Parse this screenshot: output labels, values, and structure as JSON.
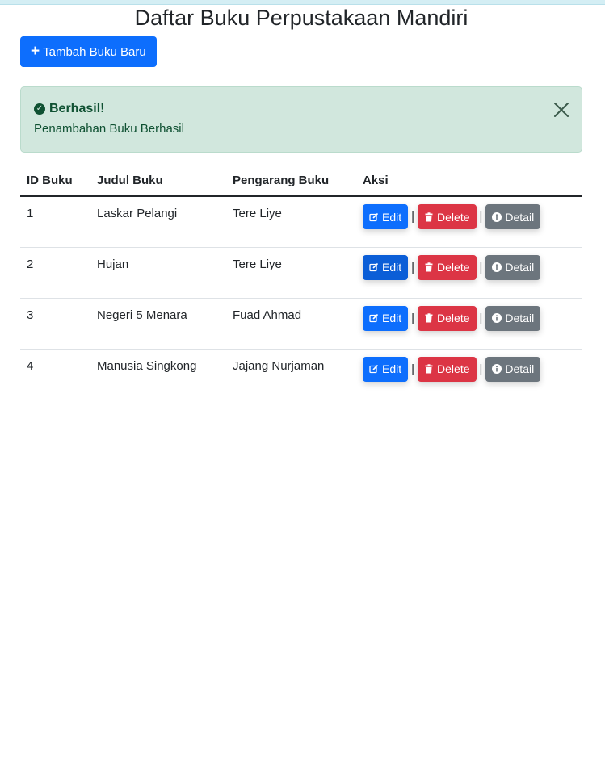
{
  "page": {
    "title": "Daftar Buku Perpustakaan Mandiri",
    "add_button": "Tambah Buku Baru"
  },
  "alert": {
    "heading": "Berhasil!",
    "message": "Penambahan Buku Berhasil",
    "icon": "check-circle-icon",
    "colors": {
      "background": "#d1e7dd",
      "text": "#0f5132"
    }
  },
  "table": {
    "headers": [
      "ID Buku",
      "Judul Buku",
      "Pengarang Buku",
      "Aksi"
    ],
    "rows": [
      {
        "id": "1",
        "judul": "Laskar Pelangi",
        "pengarang": "Tere Liye"
      },
      {
        "id": "2",
        "judul": "Hujan",
        "pengarang": "Tere Liye"
      },
      {
        "id": "3",
        "judul": "Negeri 5 Menara",
        "pengarang": "Fuad Ahmad"
      },
      {
        "id": "4",
        "judul": "Manusia Singkong",
        "pengarang": "Jajang Nurjaman"
      }
    ],
    "actions": {
      "edit": "Edit",
      "delete": "Delete",
      "detail": "Detail",
      "separator": "|"
    }
  },
  "colors": {
    "primary": "#0d6efd",
    "danger": "#dc3545",
    "secondary": "#6c757d"
  }
}
